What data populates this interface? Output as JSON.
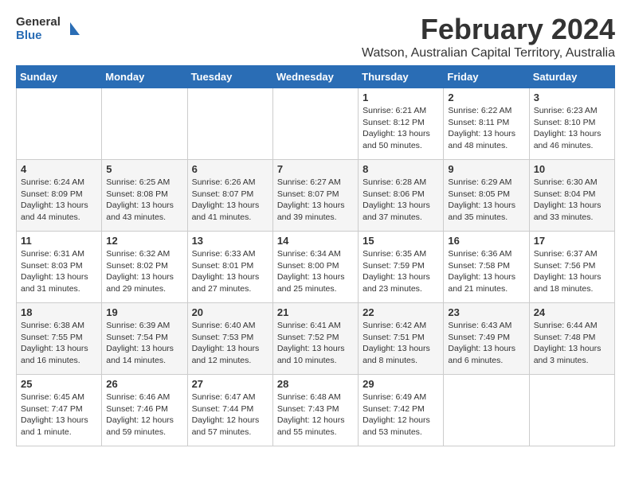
{
  "logo": {
    "general": "General",
    "blue": "Blue"
  },
  "header": {
    "month_year": "February 2024",
    "location": "Watson, Australian Capital Territory, Australia"
  },
  "weekdays": [
    "Sunday",
    "Monday",
    "Tuesday",
    "Wednesday",
    "Thursday",
    "Friday",
    "Saturday"
  ],
  "weeks": [
    [
      {
        "day": "",
        "info": ""
      },
      {
        "day": "",
        "info": ""
      },
      {
        "day": "",
        "info": ""
      },
      {
        "day": "",
        "info": ""
      },
      {
        "day": "1",
        "info": "Sunrise: 6:21 AM\nSunset: 8:12 PM\nDaylight: 13 hours\nand 50 minutes."
      },
      {
        "day": "2",
        "info": "Sunrise: 6:22 AM\nSunset: 8:11 PM\nDaylight: 13 hours\nand 48 minutes."
      },
      {
        "day": "3",
        "info": "Sunrise: 6:23 AM\nSunset: 8:10 PM\nDaylight: 13 hours\nand 46 minutes."
      }
    ],
    [
      {
        "day": "4",
        "info": "Sunrise: 6:24 AM\nSunset: 8:09 PM\nDaylight: 13 hours\nand 44 minutes."
      },
      {
        "day": "5",
        "info": "Sunrise: 6:25 AM\nSunset: 8:08 PM\nDaylight: 13 hours\nand 43 minutes."
      },
      {
        "day": "6",
        "info": "Sunrise: 6:26 AM\nSunset: 8:07 PM\nDaylight: 13 hours\nand 41 minutes."
      },
      {
        "day": "7",
        "info": "Sunrise: 6:27 AM\nSunset: 8:07 PM\nDaylight: 13 hours\nand 39 minutes."
      },
      {
        "day": "8",
        "info": "Sunrise: 6:28 AM\nSunset: 8:06 PM\nDaylight: 13 hours\nand 37 minutes."
      },
      {
        "day": "9",
        "info": "Sunrise: 6:29 AM\nSunset: 8:05 PM\nDaylight: 13 hours\nand 35 minutes."
      },
      {
        "day": "10",
        "info": "Sunrise: 6:30 AM\nSunset: 8:04 PM\nDaylight: 13 hours\nand 33 minutes."
      }
    ],
    [
      {
        "day": "11",
        "info": "Sunrise: 6:31 AM\nSunset: 8:03 PM\nDaylight: 13 hours\nand 31 minutes."
      },
      {
        "day": "12",
        "info": "Sunrise: 6:32 AM\nSunset: 8:02 PM\nDaylight: 13 hours\nand 29 minutes."
      },
      {
        "day": "13",
        "info": "Sunrise: 6:33 AM\nSunset: 8:01 PM\nDaylight: 13 hours\nand 27 minutes."
      },
      {
        "day": "14",
        "info": "Sunrise: 6:34 AM\nSunset: 8:00 PM\nDaylight: 13 hours\nand 25 minutes."
      },
      {
        "day": "15",
        "info": "Sunrise: 6:35 AM\nSunset: 7:59 PM\nDaylight: 13 hours\nand 23 minutes."
      },
      {
        "day": "16",
        "info": "Sunrise: 6:36 AM\nSunset: 7:58 PM\nDaylight: 13 hours\nand 21 minutes."
      },
      {
        "day": "17",
        "info": "Sunrise: 6:37 AM\nSunset: 7:56 PM\nDaylight: 13 hours\nand 18 minutes."
      }
    ],
    [
      {
        "day": "18",
        "info": "Sunrise: 6:38 AM\nSunset: 7:55 PM\nDaylight: 13 hours\nand 16 minutes."
      },
      {
        "day": "19",
        "info": "Sunrise: 6:39 AM\nSunset: 7:54 PM\nDaylight: 13 hours\nand 14 minutes."
      },
      {
        "day": "20",
        "info": "Sunrise: 6:40 AM\nSunset: 7:53 PM\nDaylight: 13 hours\nand 12 minutes."
      },
      {
        "day": "21",
        "info": "Sunrise: 6:41 AM\nSunset: 7:52 PM\nDaylight: 13 hours\nand 10 minutes."
      },
      {
        "day": "22",
        "info": "Sunrise: 6:42 AM\nSunset: 7:51 PM\nDaylight: 13 hours\nand 8 minutes."
      },
      {
        "day": "23",
        "info": "Sunrise: 6:43 AM\nSunset: 7:49 PM\nDaylight: 13 hours\nand 6 minutes."
      },
      {
        "day": "24",
        "info": "Sunrise: 6:44 AM\nSunset: 7:48 PM\nDaylight: 13 hours\nand 3 minutes."
      }
    ],
    [
      {
        "day": "25",
        "info": "Sunrise: 6:45 AM\nSunset: 7:47 PM\nDaylight: 13 hours\nand 1 minute."
      },
      {
        "day": "26",
        "info": "Sunrise: 6:46 AM\nSunset: 7:46 PM\nDaylight: 12 hours\nand 59 minutes."
      },
      {
        "day": "27",
        "info": "Sunrise: 6:47 AM\nSunset: 7:44 PM\nDaylight: 12 hours\nand 57 minutes."
      },
      {
        "day": "28",
        "info": "Sunrise: 6:48 AM\nSunset: 7:43 PM\nDaylight: 12 hours\nand 55 minutes."
      },
      {
        "day": "29",
        "info": "Sunrise: 6:49 AM\nSunset: 7:42 PM\nDaylight: 12 hours\nand 53 minutes."
      },
      {
        "day": "",
        "info": ""
      },
      {
        "day": "",
        "info": ""
      }
    ]
  ]
}
